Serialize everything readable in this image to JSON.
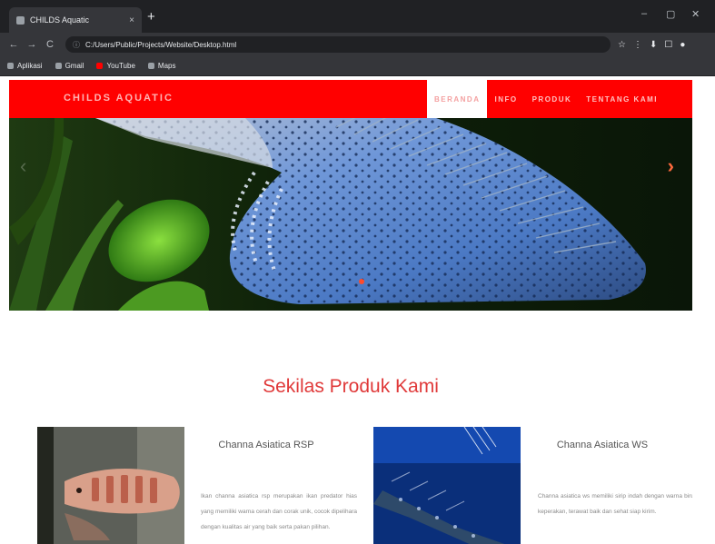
{
  "browser": {
    "tab_title": "CHILDS Aquatic",
    "tab_close": "×",
    "new_tab": "+",
    "nav": {
      "back": "←",
      "forward": "→",
      "reload": "C"
    },
    "address": "C:/Users/Public/Projects/Website/Desktop.html",
    "bookmarks": [
      {
        "label": "Aplikasi",
        "icon": "apps-icon"
      },
      {
        "label": "Gmail",
        "icon": "gmail-icon"
      },
      {
        "label": "YouTube",
        "icon": "youtube-icon"
      },
      {
        "label": "Maps",
        "icon": "maps-icon"
      }
    ],
    "extensions": [
      "☆",
      "⋮",
      "⬇",
      "☐",
      "●"
    ]
  },
  "site": {
    "brand": "CHILDS AQUATIC",
    "menu": [
      "BERANDA",
      "INFO",
      "PRODUK",
      "TENTANG KAMI"
    ],
    "active_menu_index": 0,
    "carousel": {
      "next": "›",
      "prev": "‹"
    },
    "section_title": "Sekilas Produk Kami",
    "products": [
      {
        "name": "Channa Asiatica RSP",
        "desc": "Ikan channa asiatica rsp merupakan ikan predator hias yang memiliki warna cerah dan corak unik, cocok dipelihara dengan kualitas air yang baik serta pakan pilihan."
      },
      {
        "name": "Channa Asiatica WS",
        "desc": "Channa asiatica ws memiliki sirip indah dengan warna biru keperakan, terawat baik dan sehat siap kirim."
      }
    ]
  },
  "colors": {
    "brand_red": "#ff0000",
    "title_red": "#e03a3a",
    "chrome_dark": "#202124",
    "chrome_mid": "#35363a"
  }
}
